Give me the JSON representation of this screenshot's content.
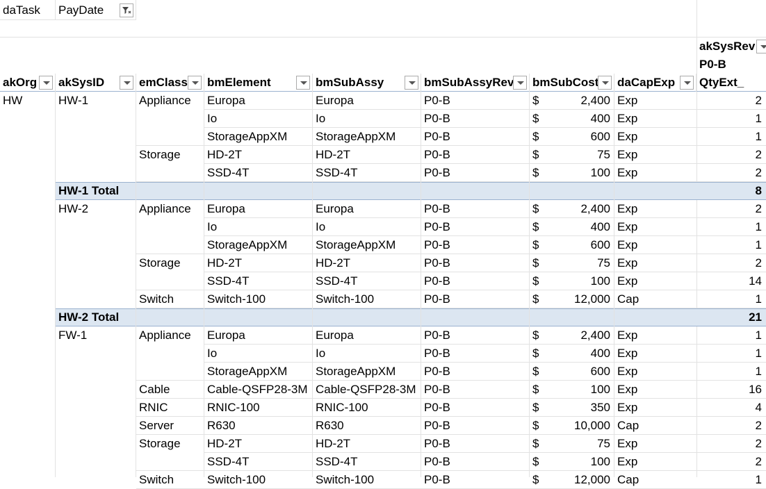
{
  "filters": [
    {
      "label": "daTask"
    },
    {
      "label": "PayDate"
    }
  ],
  "column_field": {
    "label": "akSysRev",
    "value": "P0-B",
    "value_field": "QtyExt_"
  },
  "columns": [
    "akOrg",
    "akSysID",
    "emClass",
    "bmElement",
    "bmSubAssy",
    "bmSubAssyRev",
    "bmSubCost",
    "daCapExp"
  ],
  "currency_symbol": "$",
  "rows": [
    {
      "type": "data",
      "org": "HW",
      "sys": "HW-1",
      "cls": "Appliance",
      "el": "Europa",
      "sub": "Europa",
      "rev": "P0-B",
      "cost": "2,400",
      "cap": "Exp",
      "qty": "2"
    },
    {
      "type": "data",
      "org": "",
      "sys": "",
      "cls": "",
      "el": "Io",
      "sub": "Io",
      "rev": "P0-B",
      "cost": "400",
      "cap": "Exp",
      "qty": "1"
    },
    {
      "type": "data",
      "org": "",
      "sys": "",
      "cls": "",
      "el": "StorageAppXM",
      "sub": "StorageAppXM",
      "rev": "P0-B",
      "cost": "600",
      "cap": "Exp",
      "qty": "1"
    },
    {
      "type": "data",
      "org": "",
      "sys": "",
      "cls": "Storage",
      "el": "HD-2T",
      "sub": "HD-2T",
      "rev": "P0-B",
      "cost": "75",
      "cap": "Exp",
      "qty": "2"
    },
    {
      "type": "data",
      "org": "",
      "sys": "",
      "cls": "",
      "el": "SSD-4T",
      "sub": "SSD-4T",
      "rev": "P0-B",
      "cost": "100",
      "cap": "Exp",
      "qty": "2"
    },
    {
      "type": "total",
      "label": "HW-1 Total",
      "qty": "8"
    },
    {
      "type": "data",
      "org": "",
      "sys": "HW-2",
      "cls": "Appliance",
      "el": "Europa",
      "sub": "Europa",
      "rev": "P0-B",
      "cost": "2,400",
      "cap": "Exp",
      "qty": "2"
    },
    {
      "type": "data",
      "org": "",
      "sys": "",
      "cls": "",
      "el": "Io",
      "sub": "Io",
      "rev": "P0-B",
      "cost": "400",
      "cap": "Exp",
      "qty": "1"
    },
    {
      "type": "data",
      "org": "",
      "sys": "",
      "cls": "",
      "el": "StorageAppXM",
      "sub": "StorageAppXM",
      "rev": "P0-B",
      "cost": "600",
      "cap": "Exp",
      "qty": "1"
    },
    {
      "type": "data",
      "org": "",
      "sys": "",
      "cls": "Storage",
      "el": "HD-2T",
      "sub": "HD-2T",
      "rev": "P0-B",
      "cost": "75",
      "cap": "Exp",
      "qty": "2"
    },
    {
      "type": "data",
      "org": "",
      "sys": "",
      "cls": "",
      "el": "SSD-4T",
      "sub": "SSD-4T",
      "rev": "P0-B",
      "cost": "100",
      "cap": "Exp",
      "qty": "14"
    },
    {
      "type": "data",
      "org": "",
      "sys": "",
      "cls": "Switch",
      "el": "Switch-100",
      "sub": "Switch-100",
      "rev": "P0-B",
      "cost": "12,000",
      "cap": "Cap",
      "qty": "1"
    },
    {
      "type": "total",
      "label": "HW-2 Total",
      "qty": "21"
    },
    {
      "type": "data",
      "org": "",
      "sys": "FW-1",
      "cls": "Appliance",
      "el": "Europa",
      "sub": "Europa",
      "rev": "P0-B",
      "cost": "2,400",
      "cap": "Exp",
      "qty": "1"
    },
    {
      "type": "data",
      "org": "",
      "sys": "",
      "cls": "",
      "el": "Io",
      "sub": "Io",
      "rev": "P0-B",
      "cost": "400",
      "cap": "Exp",
      "qty": "1"
    },
    {
      "type": "data",
      "org": "",
      "sys": "",
      "cls": "",
      "el": "StorageAppXM",
      "sub": "StorageAppXM",
      "rev": "P0-B",
      "cost": "600",
      "cap": "Exp",
      "qty": "1"
    },
    {
      "type": "data",
      "org": "",
      "sys": "",
      "cls": "Cable",
      "el": "Cable-QSFP28-3M",
      "sub": "Cable-QSFP28-3M",
      "rev": "P0-B",
      "cost": "100",
      "cap": "Exp",
      "qty": "16"
    },
    {
      "type": "data",
      "org": "",
      "sys": "",
      "cls": "RNIC",
      "el": "RNIC-100",
      "sub": "RNIC-100",
      "rev": "P0-B",
      "cost": "350",
      "cap": "Exp",
      "qty": "4"
    },
    {
      "type": "data",
      "org": "",
      "sys": "",
      "cls": "Server",
      "el": "R630",
      "sub": "R630",
      "rev": "P0-B",
      "cost": "10,000",
      "cap": "Cap",
      "qty": "2"
    },
    {
      "type": "data",
      "org": "",
      "sys": "",
      "cls": "Storage",
      "el": "HD-2T",
      "sub": "HD-2T",
      "rev": "P0-B",
      "cost": "75",
      "cap": "Exp",
      "qty": "2"
    },
    {
      "type": "data",
      "org": "",
      "sys": "",
      "cls": "",
      "el": "SSD-4T",
      "sub": "SSD-4T",
      "rev": "P0-B",
      "cost": "100",
      "cap": "Exp",
      "qty": "2"
    },
    {
      "type": "data",
      "org": "",
      "sys": "",
      "cls": "Switch",
      "el": "Switch-100",
      "sub": "Switch-100",
      "rev": "P0-B",
      "cost": "12,000",
      "cap": "Cap",
      "qty": "1"
    }
  ],
  "colors": {
    "total_band": "#dce6f1",
    "grid": "#e2e2e2",
    "header_rule": "#9bb2cf"
  }
}
